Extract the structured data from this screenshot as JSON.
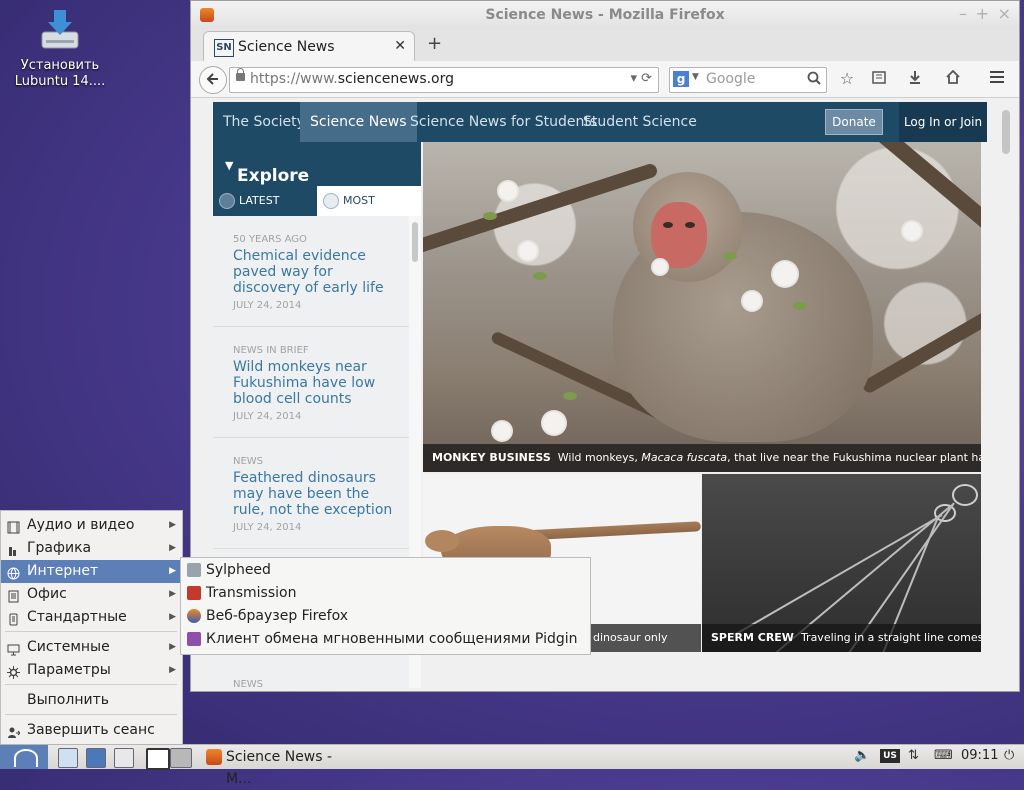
{
  "desktop": {
    "icon_label": "Установить Lubuntu 14...."
  },
  "window": {
    "title": "Science News - Mozilla Firefox",
    "tab_title": "Science News",
    "tab_favicon_text": "SN",
    "new_tab": "+",
    "url_prefix": "https://www.",
    "url_domain": "sciencenews.org",
    "search_placeholder": "Google",
    "search_engine_letter": "g"
  },
  "site": {
    "nav": [
      "The Society",
      "Science News",
      "Science News for Students",
      "Student Science"
    ],
    "donate": "Donate",
    "login": "Log In or Join",
    "explore": "Explore",
    "tab_latest": "LATEST",
    "tab_most_viewed": "MOST VIEWED",
    "stories": [
      {
        "kicker": "50 YEARS AGO",
        "headline": "Chemical evidence paved way for discovery of early life",
        "date": "JULY 24, 2014"
      },
      {
        "kicker": "NEWS IN BRIEF",
        "headline": "Wild monkeys near Fukushima have low blood cell counts",
        "date": "JULY 24, 2014"
      },
      {
        "kicker": "NEWS",
        "headline": "Feathered dinosaurs may have been the rule, not the exception",
        "date": "JULY 24, 2014"
      },
      {
        "kicker": "NEWS",
        "headline": "",
        "date": ""
      }
    ],
    "hero_caption_bold": "MONKEY BUSINESS",
    "hero_caption_pre": "Wild monkeys, ",
    "hero_caption_italic": "Macaca fuscata",
    "hero_caption_post": ", that live near the Fukushima nuclear plant have low blood",
    "tile1_caption": "dinosaur only",
    "tile2_caption_bold": "SPERM CREW",
    "tile2_caption": "Traveling in a straight line comes"
  },
  "menu": {
    "items": [
      {
        "label": "Аудио и видео",
        "has_sub": true
      },
      {
        "label": "Графика",
        "has_sub": true
      },
      {
        "label": "Интернет",
        "has_sub": true,
        "active": true
      },
      {
        "label": "Офис",
        "has_sub": true
      },
      {
        "label": "Стандартные",
        "has_sub": true
      },
      {
        "label": "Системные",
        "has_sub": true
      },
      {
        "label": "Параметры",
        "has_sub": true
      },
      {
        "label": "Выполнить",
        "has_sub": false
      },
      {
        "label": "Завершить сеанс",
        "has_sub": false
      }
    ],
    "submenu": [
      "Sylpheed",
      "Transmission",
      "Веб-браузер Firefox",
      "Клиент обмена мгновенными сообщениями Pidgin"
    ]
  },
  "taskbar": {
    "task_label": "Science News - M...",
    "keyboard_layout": "US",
    "clock": "09:11"
  },
  "colors": {
    "site_nav": "#1f4a66",
    "menu_highlight": "#5c7fb8",
    "link": "#3a78a4"
  }
}
